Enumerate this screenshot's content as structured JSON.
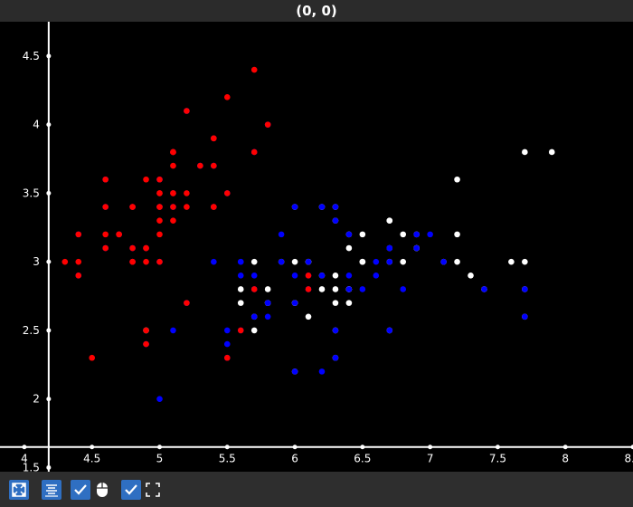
{
  "window": {
    "title": "(0, 0)"
  },
  "toolbar": {
    "buttons": [
      {
        "name": "auto-scale-icon"
      },
      {
        "name": "legend-list-icon"
      },
      {
        "name": "mouse-mode-check",
        "checked": true
      },
      {
        "name": "fullscreen-check",
        "checked": true
      }
    ]
  },
  "chart_data": {
    "type": "scatter",
    "title": "",
    "xlabel": "",
    "ylabel": "",
    "xlim": [
      3.82,
      8.5
    ],
    "ylim": [
      1.47,
      4.75
    ],
    "grid": false,
    "x_ticks": [
      "4",
      "4.5",
      "5",
      "5.5",
      "6",
      "6.5",
      "7",
      "7.5",
      "8",
      "8.5"
    ],
    "y_ticks": [
      "1.5",
      "2",
      "2.5",
      "3",
      "3.5",
      "4",
      "4.5"
    ],
    "series": [
      {
        "color": "#ff0000",
        "points": [
          [
            5.1,
            3.5
          ],
          [
            4.9,
            3.0
          ],
          [
            4.7,
            3.2
          ],
          [
            4.6,
            3.1
          ],
          [
            5.0,
            3.6
          ],
          [
            5.4,
            3.9
          ],
          [
            4.6,
            3.4
          ],
          [
            5.0,
            3.4
          ],
          [
            4.4,
            2.9
          ],
          [
            4.9,
            3.1
          ],
          [
            5.4,
            3.7
          ],
          [
            4.8,
            3.4
          ],
          [
            4.8,
            3.0
          ],
          [
            4.3,
            3.0
          ],
          [
            5.8,
            4.0
          ],
          [
            5.7,
            4.4
          ],
          [
            5.4,
            3.9
          ],
          [
            5.1,
            3.5
          ],
          [
            5.7,
            3.8
          ],
          [
            5.1,
            3.8
          ],
          [
            5.4,
            3.4
          ],
          [
            5.1,
            3.7
          ],
          [
            4.6,
            3.6
          ],
          [
            5.1,
            3.3
          ],
          [
            4.8,
            3.4
          ],
          [
            5.0,
            3.0
          ],
          [
            5.0,
            3.4
          ],
          [
            5.2,
            3.5
          ],
          [
            5.2,
            3.4
          ],
          [
            4.7,
            3.2
          ],
          [
            4.8,
            3.1
          ],
          [
            5.4,
            3.4
          ],
          [
            5.2,
            4.1
          ],
          [
            5.5,
            4.2
          ],
          [
            4.9,
            3.1
          ],
          [
            5.0,
            3.2
          ],
          [
            5.5,
            3.5
          ],
          [
            4.9,
            3.6
          ],
          [
            4.4,
            3.0
          ],
          [
            5.1,
            3.4
          ],
          [
            5.0,
            3.5
          ],
          [
            4.5,
            2.3
          ],
          [
            4.4,
            3.2
          ],
          [
            5.0,
            3.5
          ],
          [
            5.1,
            3.8
          ],
          [
            4.8,
            3.0
          ],
          [
            5.1,
            3.8
          ],
          [
            4.6,
            3.2
          ],
          [
            5.3,
            3.7
          ],
          [
            5.0,
            3.3
          ],
          [
            4.9,
            2.4
          ],
          [
            5.2,
            2.7
          ],
          [
            5.5,
            2.3
          ],
          [
            5.7,
            2.8
          ],
          [
            5.6,
            2.5
          ],
          [
            6.1,
            2.8
          ],
          [
            6.1,
            2.9
          ],
          [
            4.9,
            2.5
          ]
        ]
      },
      {
        "color": "#0000ff",
        "points": [
          [
            7.0,
            3.2
          ],
          [
            6.4,
            3.2
          ],
          [
            6.9,
            3.1
          ],
          [
            5.5,
            2.3
          ],
          [
            6.5,
            2.8
          ],
          [
            5.7,
            2.8
          ],
          [
            6.3,
            3.3
          ],
          [
            4.9,
            2.4
          ],
          [
            6.6,
            2.9
          ],
          [
            5.2,
            2.7
          ],
          [
            5.0,
            2.0
          ],
          [
            5.9,
            3.0
          ],
          [
            6.0,
            2.2
          ],
          [
            6.1,
            2.9
          ],
          [
            5.6,
            2.9
          ],
          [
            6.7,
            3.1
          ],
          [
            5.6,
            3.0
          ],
          [
            5.8,
            2.7
          ],
          [
            6.2,
            2.2
          ],
          [
            5.6,
            2.5
          ],
          [
            5.9,
            3.2
          ],
          [
            6.1,
            2.8
          ],
          [
            6.3,
            2.5
          ],
          [
            6.4,
            2.9
          ],
          [
            6.6,
            3.0
          ],
          [
            6.8,
            2.8
          ],
          [
            6.7,
            3.0
          ],
          [
            6.0,
            2.9
          ],
          [
            5.7,
            2.6
          ],
          [
            5.5,
            2.4
          ],
          [
            5.8,
            2.7
          ],
          [
            6.0,
            2.7
          ],
          [
            5.4,
            3.0
          ],
          [
            6.0,
            3.4
          ],
          [
            6.7,
            3.1
          ],
          [
            6.3,
            2.3
          ],
          [
            5.6,
            3.0
          ],
          [
            5.5,
            2.5
          ],
          [
            6.1,
            3.0
          ],
          [
            5.8,
            2.6
          ],
          [
            5.1,
            2.5
          ],
          [
            5.7,
            2.9
          ],
          [
            6.2,
            2.9
          ],
          [
            6.4,
            2.8
          ],
          [
            6.7,
            2.5
          ],
          [
            7.4,
            2.8
          ],
          [
            7.7,
            2.6
          ],
          [
            7.1,
            3.0
          ],
          [
            6.9,
            3.2
          ],
          [
            7.7,
            2.8
          ],
          [
            6.3,
            3.4
          ],
          [
            6.2,
            3.4
          ],
          [
            4.4,
            3.2
          ],
          [
            5.4,
            3.4
          ],
          [
            4.9,
            3.1
          ],
          [
            4.4,
            2.9
          ],
          [
            5.0,
            3.6
          ],
          [
            4.6,
            3.4
          ],
          [
            5.4,
            3.7
          ],
          [
            4.8,
            3.4
          ],
          [
            5.7,
            3.8
          ],
          [
            5.1,
            3.8
          ],
          [
            5.8,
            4.0
          ],
          [
            5.2,
            4.1
          ],
          [
            4.6,
            3.6
          ],
          [
            5.1,
            3.5
          ],
          [
            5.3,
            3.7
          ],
          [
            5.0,
            3.4
          ],
          [
            4.8,
            3.1
          ],
          [
            5.4,
            3.9
          ],
          [
            4.7,
            3.2
          ],
          [
            5.0,
            3.0
          ],
          [
            5.1,
            3.4
          ],
          [
            4.8,
            3.0
          ],
          [
            4.6,
            3.1
          ],
          [
            5.5,
            3.5
          ]
        ]
      },
      {
        "color": "#ffffff",
        "points": [
          [
            6.3,
            3.3
          ],
          [
            5.8,
            2.7
          ],
          [
            7.1,
            3.0
          ],
          [
            6.3,
            2.9
          ],
          [
            6.5,
            3.0
          ],
          [
            7.6,
            3.0
          ],
          [
            4.9,
            2.5
          ],
          [
            7.3,
            2.9
          ],
          [
            6.7,
            2.5
          ],
          [
            7.2,
            3.6
          ],
          [
            6.5,
            3.2
          ],
          [
            6.4,
            2.7
          ],
          [
            6.8,
            3.0
          ],
          [
            5.7,
            2.5
          ],
          [
            5.8,
            2.8
          ],
          [
            6.4,
            3.2
          ],
          [
            6.5,
            3.0
          ],
          [
            7.7,
            3.8
          ],
          [
            7.7,
            2.6
          ],
          [
            6.0,
            2.2
          ],
          [
            6.9,
            3.2
          ],
          [
            5.6,
            2.8
          ],
          [
            7.7,
            2.8
          ],
          [
            6.3,
            2.7
          ],
          [
            6.7,
            3.3
          ],
          [
            7.2,
            3.2
          ],
          [
            6.2,
            2.8
          ],
          [
            6.1,
            3.0
          ],
          [
            6.4,
            2.8
          ],
          [
            7.2,
            3.0
          ],
          [
            7.4,
            2.8
          ],
          [
            7.9,
            3.8
          ],
          [
            6.4,
            2.8
          ],
          [
            6.3,
            2.8
          ],
          [
            6.1,
            2.6
          ],
          [
            7.7,
            3.0
          ],
          [
            6.3,
            3.4
          ],
          [
            6.4,
            3.1
          ],
          [
            6.0,
            3.0
          ],
          [
            6.9,
            3.1
          ],
          [
            6.7,
            3.1
          ],
          [
            6.9,
            3.1
          ],
          [
            5.8,
            2.7
          ],
          [
            6.8,
            3.2
          ],
          [
            6.7,
            3.3
          ],
          [
            6.7,
            3.0
          ],
          [
            6.3,
            2.5
          ],
          [
            6.5,
            3.0
          ],
          [
            6.2,
            3.4
          ],
          [
            5.9,
            3.0
          ],
          [
            6.0,
            2.7
          ],
          [
            5.7,
            2.6
          ],
          [
            6.3,
            2.3
          ],
          [
            5.6,
            2.7
          ],
          [
            6.1,
            3.0
          ],
          [
            5.8,
            2.7
          ],
          [
            6.0,
            3.4
          ],
          [
            6.2,
            2.9
          ],
          [
            5.7,
            3.0
          ],
          [
            6.0,
            2.7
          ]
        ]
      }
    ]
  }
}
